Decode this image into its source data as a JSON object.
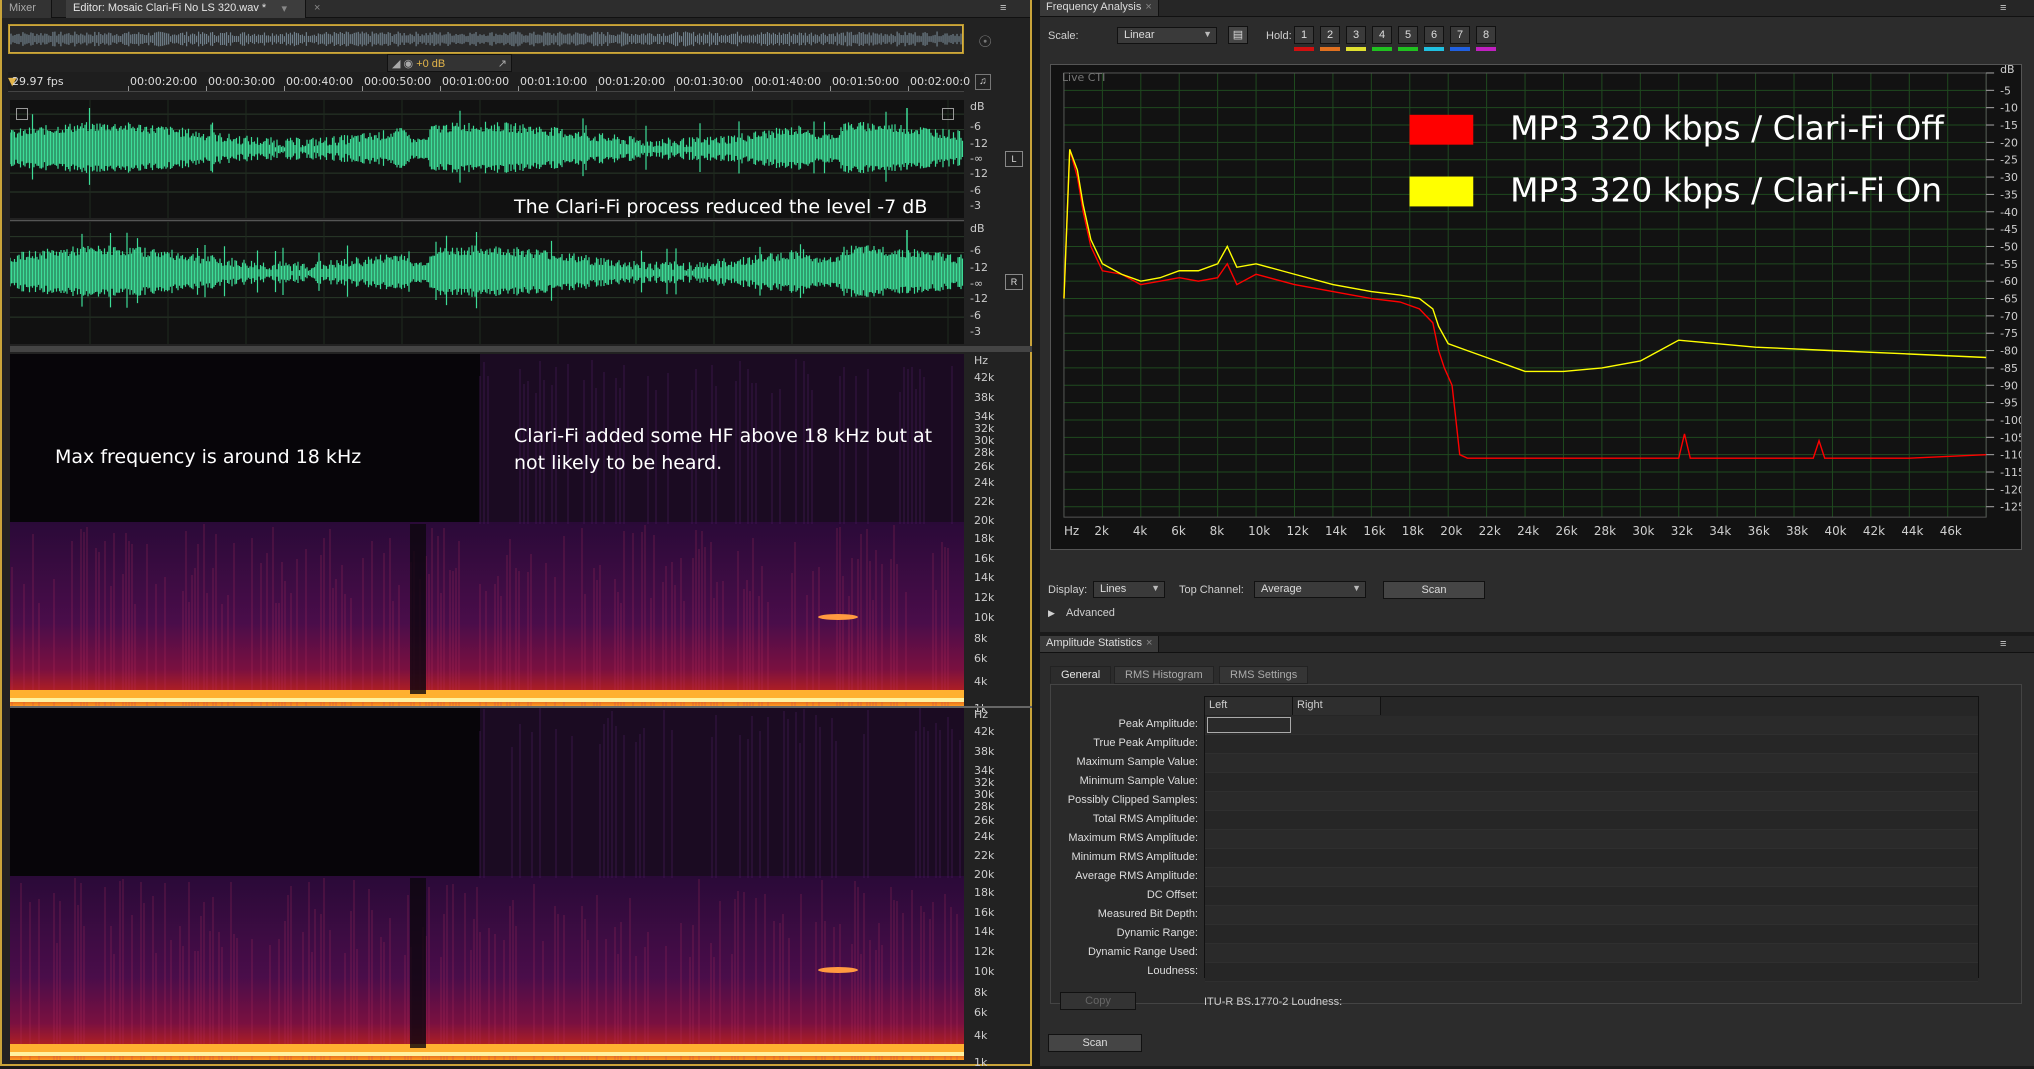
{
  "editor": {
    "tabs": [
      {
        "label": "Mixer"
      },
      {
        "label": "Editor: Mosaic Clari-Fi No LS 320.wav *"
      }
    ],
    "zoom_value": "+0 dB",
    "fps_label": "29.97 fps",
    "timeline": [
      "00:00:20:00",
      "00:00:30:00",
      "00:00:40:00",
      "00:00:50:00",
      "00:01:00:00",
      "00:01:10:00",
      "00:01:20:00",
      "00:01:30:00",
      "00:01:40:00",
      "00:01:50:00",
      "00:02:00:0"
    ],
    "db_scale_left": [
      "dB",
      "-6",
      "-12",
      "-∞",
      "-12",
      "-6",
      "-3"
    ],
    "db_scale_right": [
      "dB",
      "-6",
      "-12",
      "-∞",
      "-12",
      "-6",
      "-3"
    ],
    "channel_left": "L",
    "channel_right": "R",
    "waveform_note": "The Clari-Fi process reduced the level -7 dB",
    "hz_scale": [
      "Hz",
      "42k",
      "38k",
      "34k",
      "32k",
      "30k",
      "28k",
      "26k",
      "24k",
      "22k",
      "20k",
      "18k",
      "16k",
      "14k",
      "12k",
      "10k",
      "8k",
      "6k",
      "4k",
      "1k"
    ],
    "spectral_note_left": "Max frequency is around 18 kHz",
    "spectral_note_right_1": "Clari-Fi added some HF above 18 kHz but at",
    "spectral_note_right_2": "not likely to be heard.",
    "waveform_color": "#3ddc97"
  },
  "frequency_analysis": {
    "title": "Frequency Analysis",
    "scale_label": "Scale:",
    "scale_value": "Linear",
    "hold_label": "Hold:",
    "hold_buttons": [
      "1",
      "2",
      "3",
      "4",
      "5",
      "6",
      "7",
      "8"
    ],
    "hold_colors": [
      "#d01010",
      "#e07020",
      "#e0e030",
      "#20c020",
      "#20c020",
      "#20c0e0",
      "#2060e0",
      "#c020c0"
    ],
    "live_label": "Live CTI",
    "legend": [
      {
        "label": "MP3 320 kbps / Clari-Fi Off",
        "color": "#ff0000"
      },
      {
        "label": "MP3 320 kbps / Clari-Fi On",
        "color": "#ffff00"
      }
    ],
    "display_label": "Display:",
    "display_value": "Lines",
    "top_channel_label": "Top Channel:",
    "top_channel_value": "Average",
    "scan_label": "Scan",
    "advanced_label": "Advanced"
  },
  "chart_data": {
    "type": "line",
    "xlabel": "Hz",
    "ylabel": "dB",
    "xlim": [
      0,
      48000
    ],
    "ylim": [
      -128,
      0
    ],
    "x_ticks": [
      "Hz",
      "2k",
      "4k",
      "6k",
      "8k",
      "10k",
      "12k",
      "14k",
      "16k",
      "18k",
      "20k",
      "22k",
      "24k",
      "26k",
      "28k",
      "30k",
      "32k",
      "34k",
      "36k",
      "38k",
      "40k",
      "42k",
      "44k",
      "46k"
    ],
    "y_ticks": [
      "dB",
      "-5",
      "-10",
      "-15",
      "-20",
      "-25",
      "-30",
      "-35",
      "-40",
      "-45",
      "-50",
      "-55",
      "-60",
      "-65",
      "-70",
      "-75",
      "-80",
      "-85",
      "-90",
      "-95",
      "-100",
      "-105",
      "-110",
      "-115",
      "-120",
      "-125"
    ],
    "grid": true,
    "legend_position": "top-right",
    "series": [
      {
        "name": "MP3 320 kbps / Clari-Fi Off",
        "color": "#ff0000",
        "x": [
          0,
          300,
          700,
          1000,
          1400,
          2000,
          3000,
          4000,
          5000,
          6000,
          7000,
          8000,
          8500,
          9000,
          10000,
          12000,
          14000,
          16000,
          17500,
          18500,
          19200,
          19500,
          19800,
          20200,
          20400,
          20600,
          21000,
          24000,
          28000,
          32000,
          32300,
          32600,
          34000,
          38000,
          39000,
          39300,
          39600,
          40000,
          44000,
          48000
        ],
        "y": [
          -65,
          -22,
          -30,
          -40,
          -50,
          -57,
          -58,
          -61,
          -60,
          -59,
          -60,
          -59,
          -55,
          -61,
          -58,
          -61,
          -63,
          -65,
          -66,
          -68,
          -72,
          -80,
          -85,
          -90,
          -100,
          -110,
          -111,
          -111,
          -111,
          -111,
          -104,
          -111,
          -111,
          -111,
          -111,
          -106,
          -111,
          -111,
          -111,
          -110
        ]
      },
      {
        "name": "MP3 320 kbps / Clari-Fi On",
        "color": "#ffff00",
        "x": [
          0,
          300,
          700,
          1000,
          1400,
          2000,
          3000,
          4000,
          5000,
          6000,
          7000,
          8000,
          8500,
          9000,
          10000,
          12000,
          14000,
          16000,
          17500,
          18500,
          19200,
          19500,
          20000,
          21000,
          22000,
          24000,
          26000,
          28000,
          30000,
          31000,
          32000,
          34000,
          36000,
          40000,
          44000,
          48000
        ],
        "y": [
          -65,
          -22,
          -28,
          -38,
          -48,
          -55,
          -58,
          -60,
          -59,
          -57,
          -57,
          -55,
          -50,
          -56,
          -55,
          -58,
          -61,
          -63,
          -64,
          -65,
          -68,
          -73,
          -78,
          -80,
          -82,
          -86,
          -86,
          -85,
          -83,
          -80,
          -77,
          -78,
          -79,
          -80,
          -81,
          -82
        ]
      }
    ]
  },
  "amplitude_statistics": {
    "title": "Amplitude Statistics",
    "tabs": [
      "General",
      "RMS Histogram",
      "RMS Settings"
    ],
    "columns": [
      "Left",
      "Right"
    ],
    "rows": [
      "Peak Amplitude:",
      "True Peak Amplitude:",
      "Maximum Sample Value:",
      "Minimum Sample Value:",
      "Possibly Clipped Samples:",
      "Total RMS Amplitude:",
      "Maximum RMS Amplitude:",
      "Minimum RMS Amplitude:",
      "Average RMS Amplitude:",
      "DC Offset:",
      "Measured Bit Depth:",
      "Dynamic Range:",
      "Dynamic Range Used:",
      "Loudness:"
    ],
    "copy_label": "Copy",
    "itu_label": "ITU-R BS.1770-2 Loudness:",
    "scan_label": "Scan"
  }
}
